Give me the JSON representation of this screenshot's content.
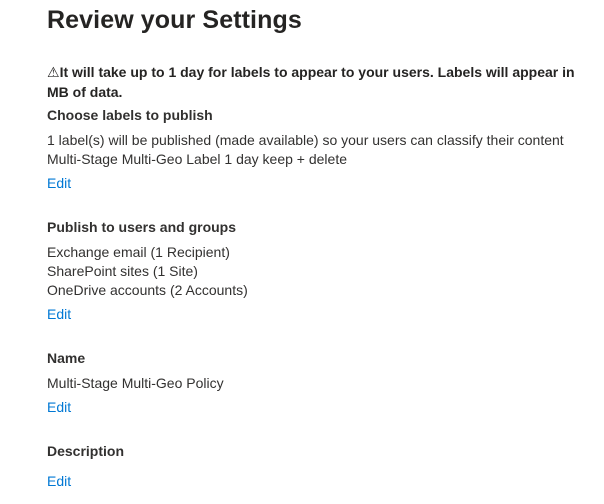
{
  "page": {
    "title": "Review your Settings",
    "warning_icon": "⚠",
    "warning_text": "It will take up to 1 day for labels to appear to your users. Labels will appear in MB of data."
  },
  "sections": {
    "labels": {
      "title": "Choose labels to publish",
      "lines": [
        "1 label(s) will be published (made available) so your users can classify their content",
        "Multi-Stage Multi-Geo Label 1 day keep + delete"
      ],
      "edit_label": "Edit"
    },
    "users": {
      "title": "Publish to users and groups",
      "lines": [
        "Exchange email (1 Recipient)",
        "SharePoint sites (1 Site)",
        "OneDrive accounts (2 Accounts)"
      ],
      "edit_label": "Edit"
    },
    "name": {
      "title": "Name",
      "lines": [
        "Multi-Stage Multi-Geo Policy"
      ],
      "edit_label": "Edit"
    },
    "description": {
      "title": "Description",
      "lines": [],
      "edit_label": "Edit"
    }
  },
  "colors": {
    "link": "#0078d4",
    "text": "#323130"
  }
}
